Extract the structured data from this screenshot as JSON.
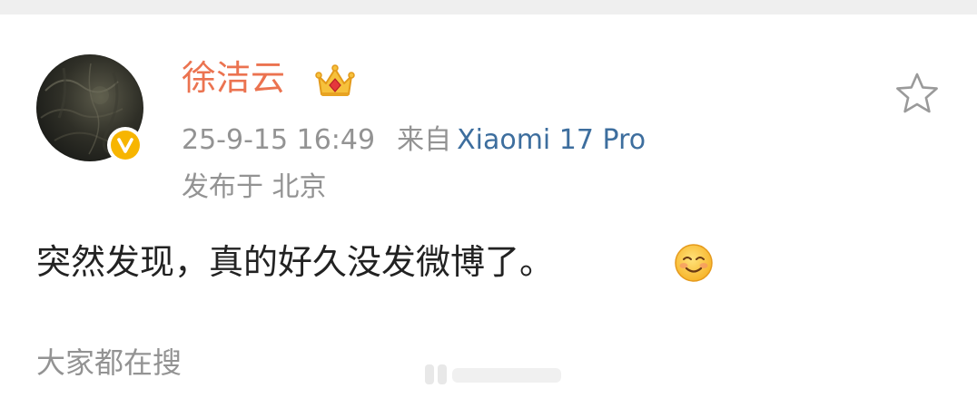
{
  "post": {
    "author": {
      "name": "徐洁云",
      "avatar_icon": "avatar-dark-texture",
      "verified_badge_icon": "yellow-v-verified-icon",
      "vip_icon": "crown-icon"
    },
    "timestamp": "25-9-15 16:49",
    "source_prefix": "来自",
    "source_device": "Xiaomi 17 Pro",
    "location": "发布于 北京",
    "content": "突然发现，真的好久没发微博了。",
    "emoji": "smiling-face-icon",
    "favorite_icon": "star-outline-icon"
  },
  "hot_search": {
    "title": "大家都在搜"
  },
  "colors": {
    "username": "#eb7350",
    "meta": "#939393",
    "source_link": "#3d6e9e",
    "content": "#222222",
    "badge": "#f7b500"
  }
}
